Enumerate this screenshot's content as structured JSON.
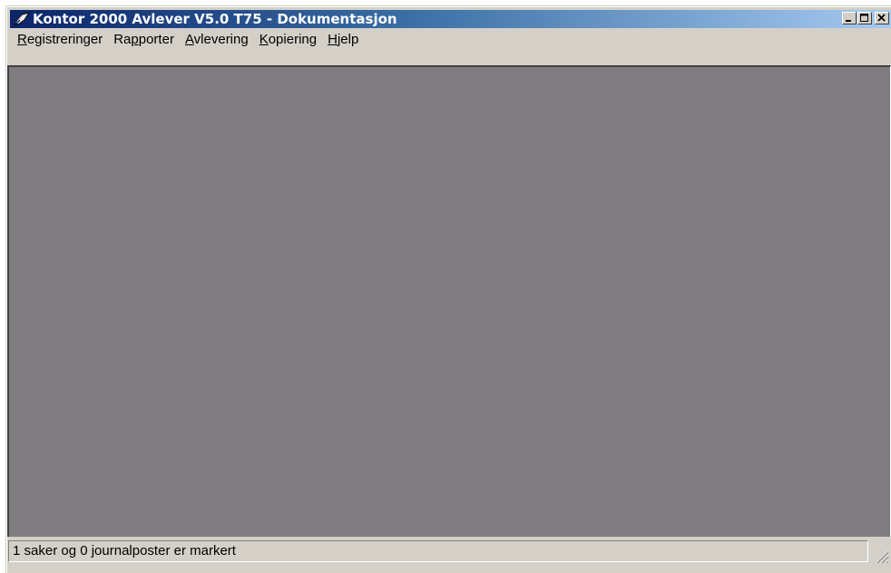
{
  "window": {
    "title": "Kontor 2000 Avlever V5.0 T75 - Dokumentasjon",
    "icon": "pen-feather-icon",
    "buttons": [
      "minimize-icon",
      "maximize-icon",
      "close-icon"
    ]
  },
  "menu": {
    "items": [
      {
        "accel": "R",
        "rest": "egistreringer"
      },
      {
        "pre": "Ra",
        "accel": "p",
        "rest": "porter"
      },
      {
        "accel": "A",
        "rest": "vlevering"
      },
      {
        "accel": "K",
        "rest": "opiering"
      },
      {
        "accel": "H",
        "rest": "jelp"
      }
    ]
  },
  "status": {
    "text": "1 saker og 0 journalposter er markert"
  },
  "colors": {
    "title_start": "#0a246a",
    "title_end": "#a6caf0",
    "workspace": "#807d80",
    "chrome": "#d4d0c8"
  }
}
